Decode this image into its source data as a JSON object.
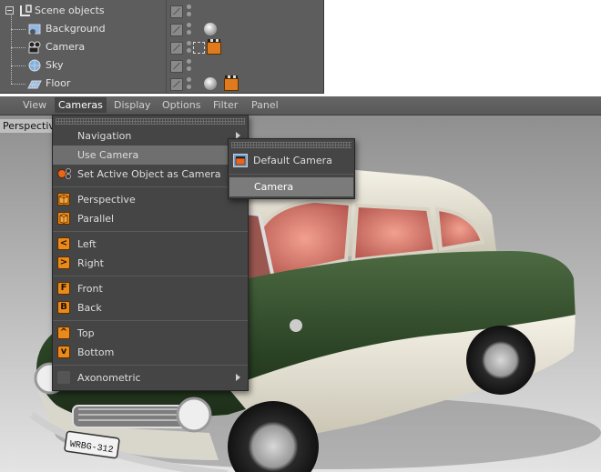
{
  "object_manager": {
    "root": {
      "label": "Scene objects",
      "icon": "layer-icon"
    },
    "objects": [
      {
        "label": "Background",
        "icon": "background-object-icon",
        "tags": [
          "material"
        ]
      },
      {
        "label": "Camera",
        "icon": "camera-object-icon",
        "tags": [
          "target",
          "clapboard"
        ]
      },
      {
        "label": "Sky",
        "icon": "sky-object-icon",
        "tags": []
      },
      {
        "label": "Floor",
        "icon": "floor-object-icon",
        "tags": [
          "material",
          "clapboard"
        ]
      }
    ]
  },
  "viewport": {
    "menubar": [
      "View",
      "Cameras",
      "Display",
      "Options",
      "Filter",
      "Panel"
    ],
    "active_menu": "Cameras",
    "label": "Perspective",
    "license_plate": "WRBG-312"
  },
  "cameras_menu": {
    "items": [
      {
        "label": "Navigation",
        "submenu": true
      },
      {
        "label": "Use Camera",
        "submenu": true,
        "highlighted": true
      },
      {
        "label": "Set Active Object as Camera",
        "icon": "set-active-camera-icon"
      },
      {
        "label": "Perspective",
        "icon": "perspective-icon"
      },
      {
        "label": "Parallel",
        "icon": "parallel-icon"
      },
      {
        "label": "Left",
        "icon": "left-view-icon",
        "glyph": "<"
      },
      {
        "label": "Right",
        "icon": "right-view-icon",
        "glyph": ">"
      },
      {
        "label": "Front",
        "icon": "front-view-icon",
        "glyph": "F"
      },
      {
        "label": "Back",
        "icon": "back-view-icon",
        "glyph": "B"
      },
      {
        "label": "Top",
        "icon": "top-view-icon",
        "glyph": "^"
      },
      {
        "label": "Bottom",
        "icon": "bottom-view-icon",
        "glyph": "v"
      },
      {
        "label": "Axonometric",
        "submenu": true
      }
    ]
  },
  "use_camera_submenu": {
    "items": [
      {
        "label": "Default Camera",
        "icon": "default-camera-icon"
      },
      {
        "label": "Camera",
        "highlighted": true
      }
    ]
  },
  "colors": {
    "panel_bg": "#5d5d5d",
    "menu_bg": "#454545",
    "highlight": "#6f6f6f",
    "icon_orange": "#e88a1c",
    "car_green": "#2f4a28",
    "car_cream": "#e6e2d4"
  }
}
